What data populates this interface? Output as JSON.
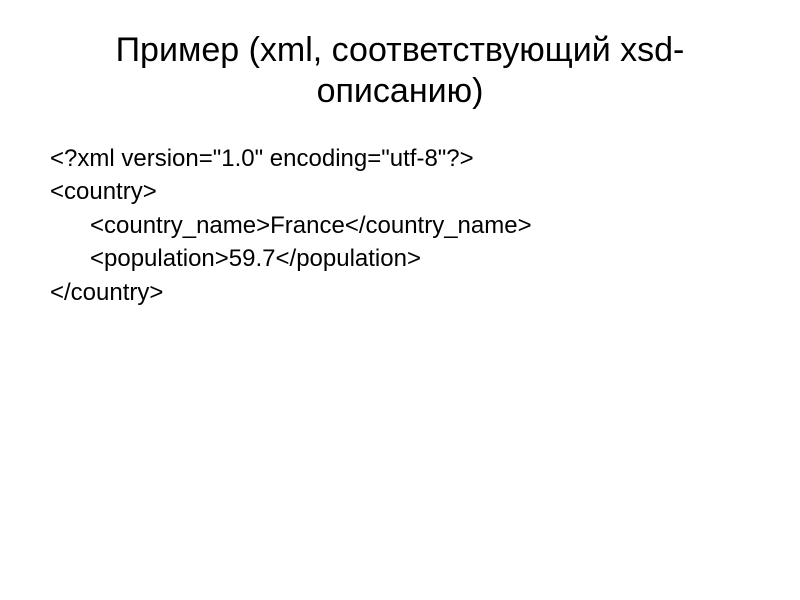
{
  "title": "Пример (xml, соответствующий xsd-описанию)",
  "code": {
    "line1": "<?xml version=\"1.0\" encoding=\"utf-8\"?>",
    "line2": "<country>",
    "line3": "<country_name>France</country_name>",
    "line4": "<population>59.7</population>",
    "line5": "</country>"
  }
}
